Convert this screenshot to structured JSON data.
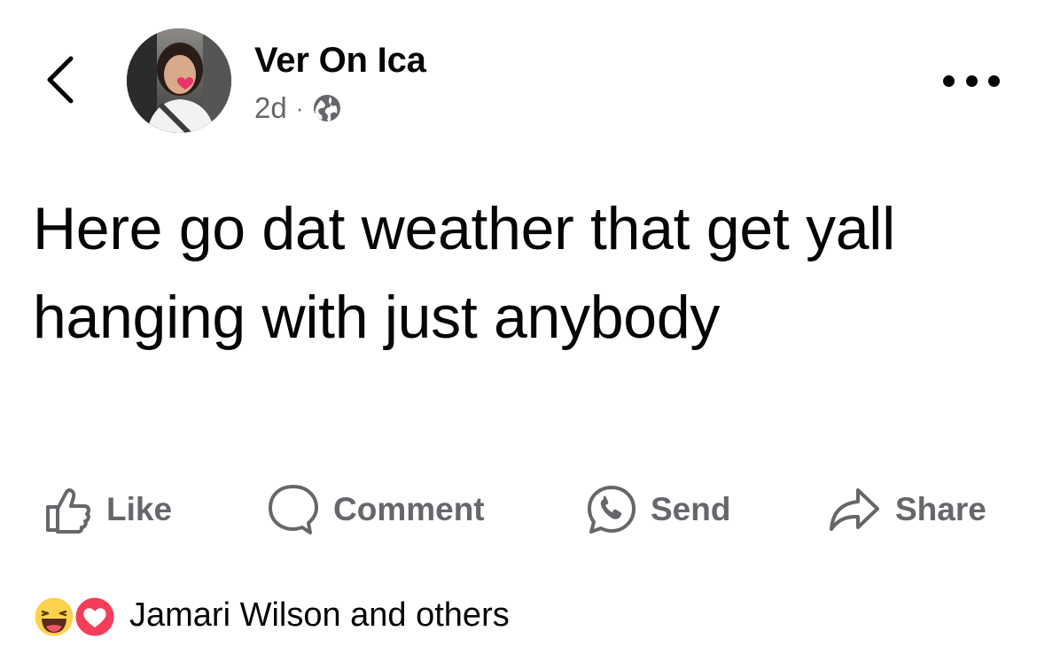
{
  "header": {
    "back_icon": "chevron-left-icon",
    "author_name": "Ver On Ica",
    "time_ago": "2d",
    "separator": "·",
    "privacy_icon": "globe-icon",
    "more_icon": "ellipsis-icon"
  },
  "post": {
    "text": "Here go dat weather that get yall hanging with just anybody"
  },
  "actions": [
    {
      "label": "Like",
      "icon": "thumbs-up-icon"
    },
    {
      "label": "Comment",
      "icon": "comment-bubble-icon"
    },
    {
      "label": "Send",
      "icon": "messenger-icon"
    },
    {
      "label": "Share",
      "icon": "share-arrow-icon"
    }
  ],
  "reactions": {
    "icons": [
      "haha-reaction-icon",
      "love-reaction-icon"
    ],
    "summary": "Jamari Wilson and others"
  },
  "colors": {
    "text_primary": "#050505",
    "text_secondary": "#65676b",
    "love_red": "#f33e58",
    "haha_yellow": "#fcd34d"
  }
}
